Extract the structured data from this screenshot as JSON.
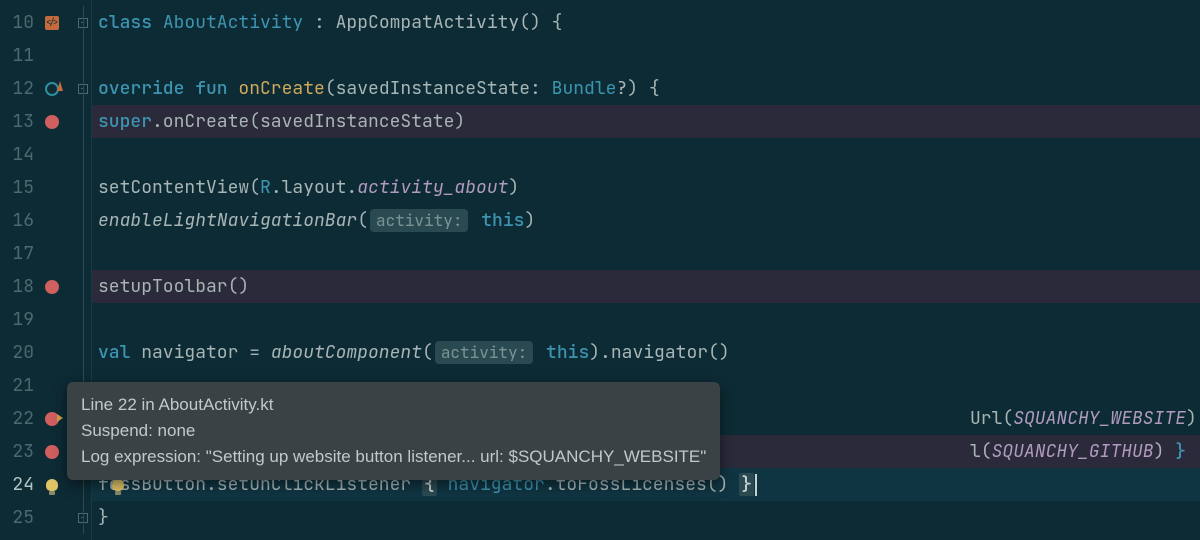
{
  "lines": [
    10,
    11,
    12,
    13,
    14,
    15,
    16,
    17,
    18,
    19,
    20,
    21,
    22,
    23,
    24,
    25
  ],
  "code": {
    "l10": {
      "tokens": [
        {
          "t": "class ",
          "c": "kw"
        },
        {
          "t": "AboutActivity",
          "c": "type"
        },
        {
          "t": " : ",
          "c": "punc"
        },
        {
          "t": "AppCompatActivity",
          "c": "id"
        },
        {
          "t": "() {",
          "c": "punc"
        }
      ]
    },
    "l12": {
      "indent": "    ",
      "tokens": [
        {
          "t": "override fun ",
          "c": "kw"
        },
        {
          "t": "onCreate",
          "c": "fn-decl"
        },
        {
          "t": "(",
          "c": "punc"
        },
        {
          "t": "savedInstanceState",
          "c": "id"
        },
        {
          "t": ": ",
          "c": "punc"
        },
        {
          "t": "Bundle",
          "c": "type"
        },
        {
          "t": "?) {",
          "c": "punc"
        }
      ]
    },
    "l13": {
      "indent": "        ",
      "tokens": [
        {
          "t": "super",
          "c": "kw"
        },
        {
          "t": ".onCreate(",
          "c": "punc"
        },
        {
          "t": "savedInstanceState",
          "c": "id"
        },
        {
          "t": ")",
          "c": "punc"
        }
      ]
    },
    "l15": {
      "indent": "        ",
      "tokens": [
        {
          "t": "setContentView(",
          "c": "id"
        },
        {
          "t": "R",
          "c": "type"
        },
        {
          "t": ".layout.",
          "c": "punc"
        },
        {
          "t": "activity_about",
          "c": "const italic"
        },
        {
          "t": ")",
          "c": "punc"
        }
      ]
    },
    "l16": {
      "indent": "        ",
      "tokens": [
        {
          "t": "enableLightNavigationBar",
          "c": "id italic"
        },
        {
          "t": "(",
          "c": "punc"
        },
        {
          "hint": "activity:"
        },
        {
          "t": " ",
          "c": ""
        },
        {
          "t": "this",
          "c": "kw"
        },
        {
          "t": ")",
          "c": "punc"
        }
      ]
    },
    "l18": {
      "indent": "        ",
      "tokens": [
        {
          "t": "setupToolbar()",
          "c": "id"
        }
      ]
    },
    "l20": {
      "indent": "        ",
      "tokens": [
        {
          "t": "val ",
          "c": "kw"
        },
        {
          "t": "navigator",
          "c": "id"
        },
        {
          "t": " = ",
          "c": "punc"
        },
        {
          "t": "aboutComponent",
          "c": "id italic"
        },
        {
          "t": "(",
          "c": "punc"
        },
        {
          "hint": "activity:"
        },
        {
          "t": " ",
          "c": ""
        },
        {
          "t": "this",
          "c": "kw"
        },
        {
          "t": ").navigator()",
          "c": "punc"
        }
      ]
    },
    "l22_tail": {
      "text": "Url(SQUANCHY_WEBSITE) }"
    },
    "l23_tail": {
      "text": "l(SQUANCHY_GITHUB) }"
    },
    "l24": {
      "indent": "        ",
      "tokens": [
        {
          "t": "fossButton",
          "c": "id"
        },
        {
          "t": ".setOnClickListener ",
          "c": "punc"
        },
        {
          "t": "{",
          "c": "brace-hl kw"
        },
        {
          "t": " navigator",
          "c": "type"
        },
        {
          "t": ".toFossLicenses() ",
          "c": "punc"
        },
        {
          "t": "}",
          "c": "brace-hl kw"
        }
      ]
    },
    "l25": {
      "indent": "    ",
      "tokens": [
        {
          "t": "}",
          "c": "punc"
        }
      ]
    }
  },
  "tooltip": {
    "line1": "Line 22 in AboutActivity.kt",
    "line2": "Suspend: none",
    "line3": "Log expression: \"Setting up website button listener... url: $SQUANCHY_WEBSITE\""
  },
  "gutter": {
    "10": {
      "icon": "file"
    },
    "12": {
      "icon": "override"
    },
    "13": {
      "icon": "breakpoint"
    },
    "18": {
      "icon": "breakpoint"
    },
    "22": {
      "icon": "log-bp"
    },
    "23": {
      "icon": "breakpoint"
    },
    "24": {
      "icon": "bulb",
      "inset": true
    }
  },
  "fold": {
    "10": "open",
    "12": "open",
    "25": "close"
  },
  "highlights": {
    "bp": [
      13,
      18,
      23
    ],
    "active": [
      24
    ]
  }
}
